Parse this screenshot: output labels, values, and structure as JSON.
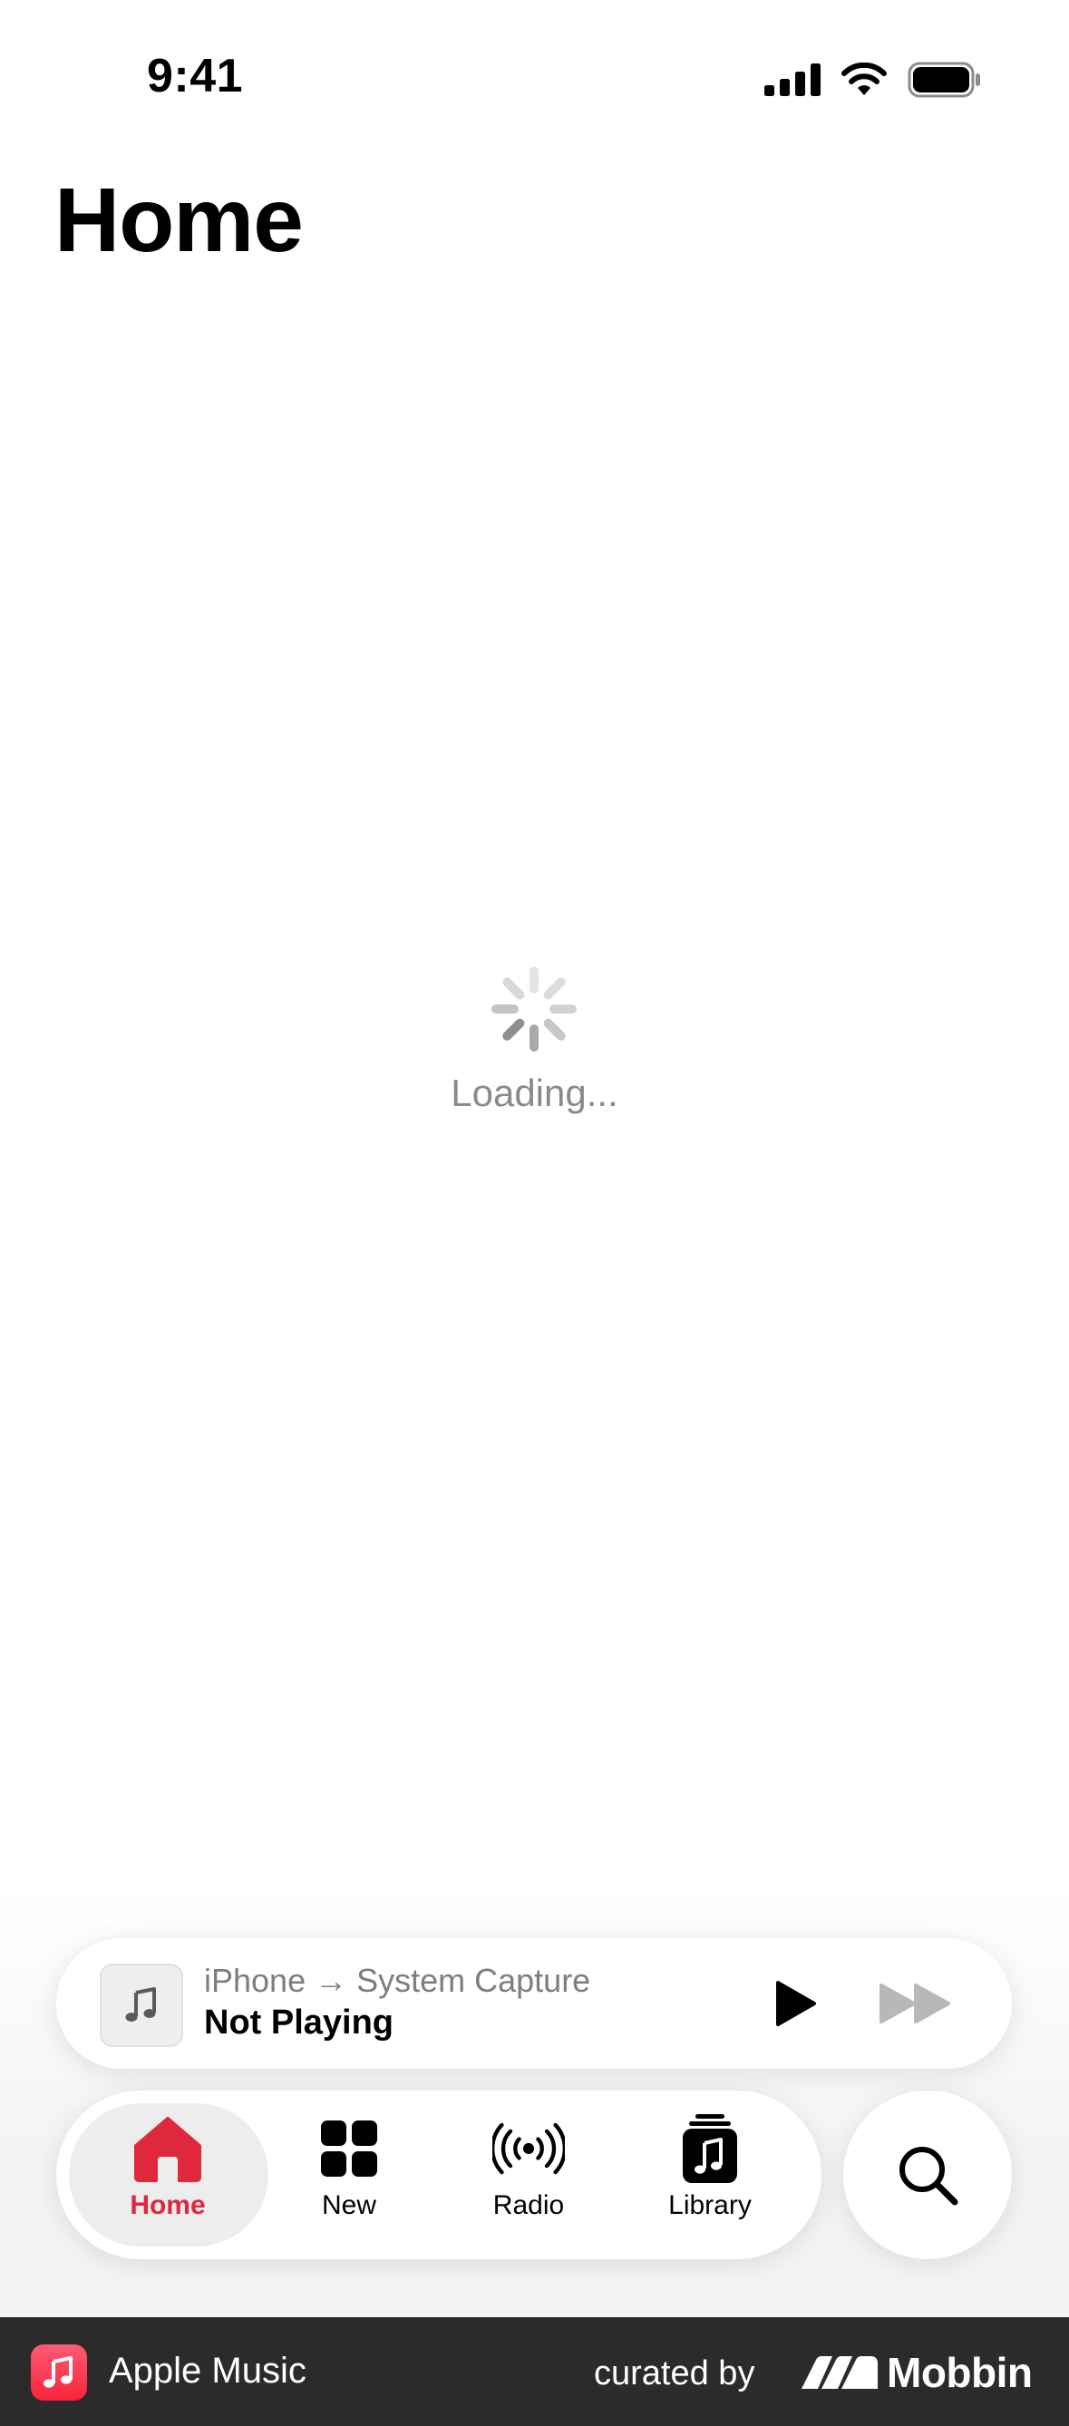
{
  "status_bar": {
    "time": "9:41",
    "icons": [
      "cellular-signal-icon",
      "wifi-icon",
      "battery-icon"
    ]
  },
  "page": {
    "title": "Home",
    "loading_text": "Loading..."
  },
  "mini_player": {
    "route": "iPhone → System Capture",
    "title": "Not Playing",
    "artwork_icon": "music-note-icon",
    "play_icon": "play-icon",
    "forward_icon": "fast-forward-icon"
  },
  "tab_bar": {
    "active_color": "#e0283d",
    "tabs": [
      {
        "label": "Home",
        "icon": "house-icon",
        "active": true
      },
      {
        "label": "New",
        "icon": "grid-icon",
        "active": false
      },
      {
        "label": "Radio",
        "icon": "radio-waves-icon",
        "active": false
      },
      {
        "label": "Library",
        "icon": "library-icon",
        "active": false
      }
    ],
    "search_icon": "search-icon"
  },
  "footer": {
    "app_name": "Apple Music",
    "curated_by": "curated by",
    "brand": "Mobbin"
  }
}
